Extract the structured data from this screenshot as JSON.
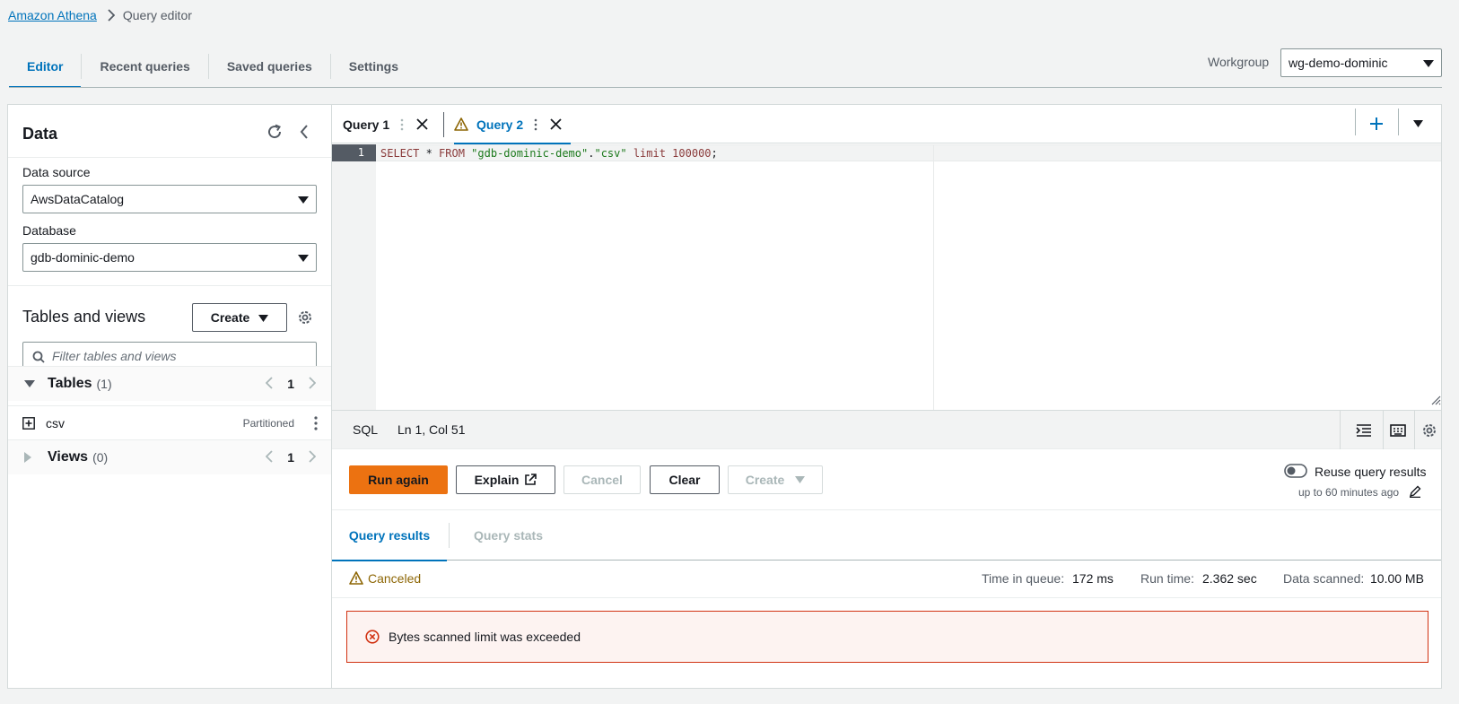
{
  "breadcrumb": {
    "root": "Amazon Athena",
    "current": "Query editor"
  },
  "top_tabs": [
    "Editor",
    "Recent queries",
    "Saved queries",
    "Settings"
  ],
  "workgroup": {
    "label": "Workgroup",
    "value": "wg-demo-dominic"
  },
  "data_panel": {
    "title": "Data",
    "data_source_label": "Data source",
    "data_source_value": "AwsDataCatalog",
    "database_label": "Database",
    "database_value": "gdb-dominic-demo",
    "tables_views_title": "Tables and views",
    "create_label": "Create",
    "filter_placeholder": "Filter tables and views",
    "tables": {
      "label": "Tables",
      "count": "(1)",
      "page": "1"
    },
    "table_items": [
      {
        "name": "csv",
        "badge": "Partitioned"
      }
    ],
    "views": {
      "label": "Views",
      "count": "(0)",
      "page": "1"
    }
  },
  "query_tabs": [
    {
      "label": "Query 1",
      "warning": false
    },
    {
      "label": "Query 2",
      "warning": true
    }
  ],
  "editor": {
    "line_number": "1",
    "code": {
      "kw1": "SELECT",
      "op1": " * ",
      "kw2": "FROM",
      "s1": " \"gdb-dominic-demo\"",
      "dot": ".",
      "s2": "\"csv\"",
      "kw3": " limit ",
      "n1": "100000",
      "end": ";"
    }
  },
  "status": {
    "language": "SQL",
    "position": "Ln 1, Col 51"
  },
  "actions": {
    "run_again": "Run again",
    "explain": "Explain",
    "cancel": "Cancel",
    "clear": "Clear",
    "create": "Create",
    "reuse_label": "Reuse query results",
    "reuse_sub": "up to 60 minutes ago"
  },
  "result_tabs": [
    "Query results",
    "Query stats"
  ],
  "stats": {
    "status": "Canceled",
    "queue_label": "Time in queue:",
    "queue_value": "172 ms",
    "run_label": "Run time:",
    "run_value": "2.362 sec",
    "scanned_label": "Data scanned:",
    "scanned_value": "10.00 MB"
  },
  "error": {
    "message": "Bytes scanned limit was exceeded"
  },
  "colors": {
    "accent": "#0073bb",
    "primary": "#ec7211",
    "warning": "#8d6605",
    "error": "#d13212"
  }
}
